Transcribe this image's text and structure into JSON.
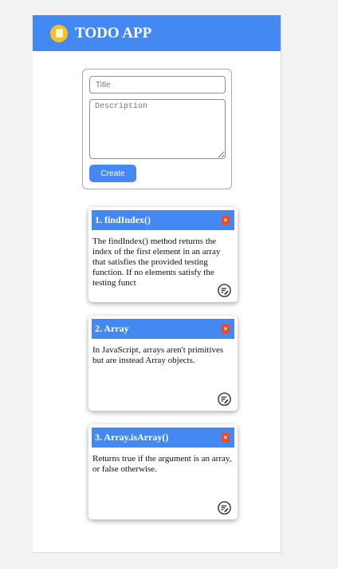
{
  "header": {
    "title": "TODO APP",
    "logo_icon": "notepad-icon"
  },
  "form": {
    "title_placeholder": "Title",
    "title_value": "",
    "description_placeholder": "Description",
    "description_value": "",
    "create_label": "Create"
  },
  "notes": [
    {
      "title": "1. findIndex()",
      "body": "The findIndex() method returns the index of the first element in an array that satisfies the provided testing function. If no elements satisfy the testing funct",
      "delete_label": "×",
      "edit_icon": "edit-icon"
    },
    {
      "title": "2. Array",
      "body": "In JavaScript, arrays aren't primitives but are instead Array objects.",
      "delete_label": "×",
      "edit_icon": "edit-icon"
    },
    {
      "title": "3. Array.isArray()",
      "body": "Returns true if the argument is an array, or false otherwise.",
      "delete_label": "×",
      "edit_icon": "edit-icon"
    }
  ],
  "colors": {
    "accent": "#4388f3",
    "logo": "#f9c21a",
    "delete": "#e84a2a"
  }
}
